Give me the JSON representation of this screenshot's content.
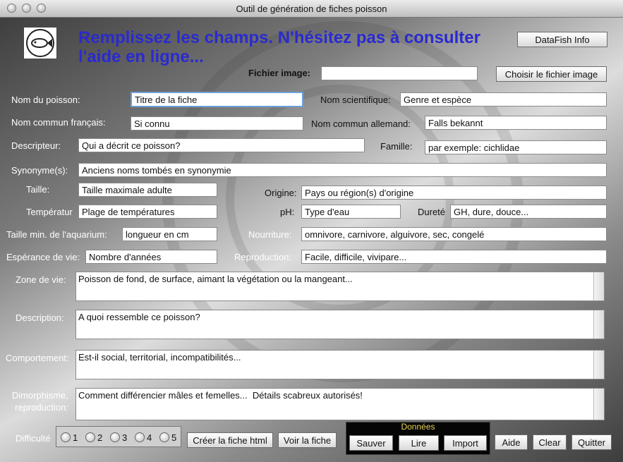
{
  "window": {
    "title": "Outil de génération de fiches poisson"
  },
  "header": {
    "heading": "Remplissez les champs. N'hésitez pas à consulter l'aide en ligne...",
    "datafish_info": "DataFish Info"
  },
  "image": {
    "label": "Fichier image:",
    "value": "",
    "choose_button": "Choisir le fichier image"
  },
  "fields": {
    "nom_poisson": {
      "label": "Nom du poisson:",
      "value": "Titre de la fiche"
    },
    "nom_scientifique": {
      "label": "Nom scientifique:",
      "value": "Genre et espèce"
    },
    "nom_francais": {
      "label": "Nom commun français:",
      "value": "Si connu"
    },
    "nom_allemand": {
      "label": "Nom commun allemand:",
      "value": "Falls bekannt"
    },
    "descripteur": {
      "label": "Descripteur:",
      "value": "Qui a décrit ce poisson?"
    },
    "famille": {
      "label": "Famille:",
      "value": "par exemple: cichlidae"
    },
    "synonymes": {
      "label": "Synonyme(s):",
      "value": "Anciens noms tombés en synonymie"
    },
    "taille": {
      "label": "Taille:",
      "value": "Taille maximale adulte"
    },
    "origine": {
      "label": "Origine:",
      "value": "Pays ou région(s) d'origine"
    },
    "temperature": {
      "label": "Températur",
      "value": "Plage de températures"
    },
    "ph": {
      "label": "pH:",
      "value": "Type d'eau"
    },
    "durete": {
      "label": "Dureté",
      "value": "GH, dure, douce..."
    },
    "taille_aquarium": {
      "label": "Taille min. de l'aquarium:",
      "value": "longueur en cm"
    },
    "nourriture": {
      "label": "Nourriture:",
      "value": "omnivore, carnivore, alguivore, sec, congelé"
    },
    "esperance": {
      "label": "Espérance de vie:",
      "value": "Nombre d'années"
    },
    "reproduction": {
      "label": "Reproduction:",
      "value": "Facile, difficile, vivipare..."
    }
  },
  "areas": {
    "zone_de_vie": {
      "label": "Zone de vie:",
      "value": "Poisson de fond, de surface, aimant la végétation ou la mangeant..."
    },
    "description": {
      "label": "Description:",
      "value": "A quoi ressemble ce poisson?"
    },
    "comportement": {
      "label": "Comportement:",
      "value": "Est-il social, territorial, incompatibilités..."
    },
    "dimorphisme": {
      "label_line1": "Dimorphisme,",
      "label_line2": "reproduction:",
      "value": "Comment différencier mâles et femelles...  Détails scabreux autorisés!"
    }
  },
  "footer": {
    "difficulty_label": "Difficulté",
    "difficulty_options": [
      "1",
      "2",
      "3",
      "4",
      "5"
    ],
    "create_html": "Créer la fiche html",
    "view_sheet": "Voir la fiche",
    "donnees_title": "Données",
    "save": "Sauver",
    "read": "Lire",
    "import": "Import",
    "help": "Aide",
    "clear": "Clear",
    "quit": "Quitter"
  }
}
